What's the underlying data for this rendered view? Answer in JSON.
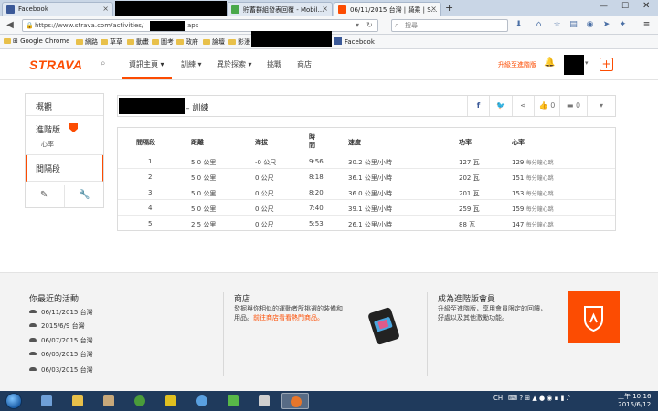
{
  "browser": {
    "tabs": [
      {
        "title": "Facebook"
      },
      {
        "title": "貯蓄群組發表回覆 - Mobil..."
      },
      {
        "title": "06/11/2015 台灣 | 騎乘 | S..."
      }
    ],
    "new_tab": "+",
    "url": "https://www.strava.com/activities/",
    "url_suffix": "aps",
    "search_placeholder": "搜尋",
    "bookmarks": [
      "Google Chrome",
      "網路",
      "草草",
      "動畫",
      "圖考",
      "政府",
      "論壇",
      "影漫",
      "Facebook"
    ]
  },
  "strava": {
    "logo": "STRAVA",
    "nav": [
      "資訊主頁",
      "訓練",
      "異於探索",
      "挑戰",
      "商店"
    ],
    "upgrade": "升級至進階版",
    "plus": "+"
  },
  "sidebar": {
    "overview": "概觀",
    "premium": "進階版",
    "heart_rate": "心率",
    "laps": "間隔段"
  },
  "activity": {
    "title_suffix": "– 訓練",
    "kudos": "0",
    "comments": "0"
  },
  "laps_table": {
    "headers": [
      "間隔段",
      "距離",
      "海拔",
      "時間",
      "速度",
      "功率",
      "心率"
    ],
    "rows": [
      {
        "lap": "1",
        "distance": "5.0 公里",
        "elev": "-0 公尺",
        "time": "9:56",
        "speed": "30.2 公里/小時",
        "power": "127 瓦",
        "hr": "129",
        "hr_unit": "每分鐘心跳"
      },
      {
        "lap": "2",
        "distance": "5.0 公里",
        "elev": "0 公尺",
        "time": "8:18",
        "speed": "36.1 公里/小時",
        "power": "202 瓦",
        "hr": "151",
        "hr_unit": "每分鐘心跳"
      },
      {
        "lap": "3",
        "distance": "5.0 公里",
        "elev": "0 公尺",
        "time": "8:20",
        "speed": "36.0 公里/小時",
        "power": "201 瓦",
        "hr": "153",
        "hr_unit": "每分鐘心跳"
      },
      {
        "lap": "4",
        "distance": "5.0 公里",
        "elev": "0 公尺",
        "time": "7:40",
        "speed": "39.1 公里/小時",
        "power": "259 瓦",
        "hr": "159",
        "hr_unit": "每分鐘心跳"
      },
      {
        "lap": "5",
        "distance": "2.5 公里",
        "elev": "0 公尺",
        "time": "5:53",
        "speed": "26.1 公里/小時",
        "power": "88 瓦",
        "hr": "147",
        "hr_unit": "每分鐘心跳"
      }
    ]
  },
  "footer": {
    "recent_title": "你最近的活動",
    "recent": [
      "06/11/2015 台灣",
      "2015/6/9 台灣",
      "06/07/2015 台灣",
      "06/05/2015 台灣",
      "06/03/2015 台灣"
    ],
    "store_title": "商店",
    "store_text": "發掘與你相似的運動者所挑選的裝備和用品。",
    "store_link": "前往商店看看熱門商品。",
    "premium_title": "成為進階版會員",
    "premium_text1": "升級至進階版，享用會員限定的回饋，",
    "premium_text2": "好處以及其他激勵功能。"
  },
  "taskbar": {
    "lang": "CH",
    "time": "上午 10:16",
    "date": "2015/6/12"
  }
}
